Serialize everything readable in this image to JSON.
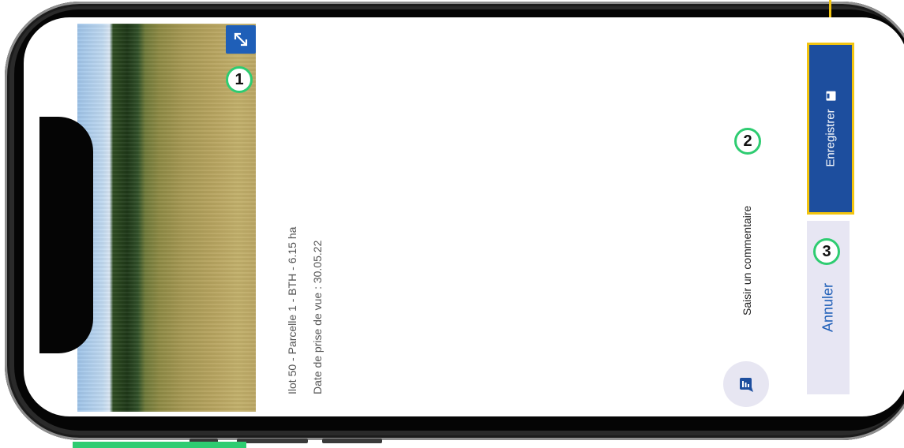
{
  "photo": {
    "expand_icon": "expand-arrows-icon",
    "badge": "1"
  },
  "details": {
    "plot_line": "Ilot 50 - Parcelle 1 - BTH - 6.15 ha",
    "date_line": "Date de prise de vue : 30.05.22"
  },
  "comment": {
    "icon": "comment-list-icon",
    "placeholder": "Saisir un commentaire",
    "badge": "2"
  },
  "actions": {
    "save_label": "Enregistrer",
    "save_icon": "floppy-disk-icon",
    "cancel_label": "Annuler",
    "cancel_badge": "3"
  },
  "colors": {
    "primary": "#1d4e9e",
    "accent_highlight": "#f2c40f",
    "badge_border": "#2ecc71",
    "cancel_bg": "#e7e6f3"
  }
}
